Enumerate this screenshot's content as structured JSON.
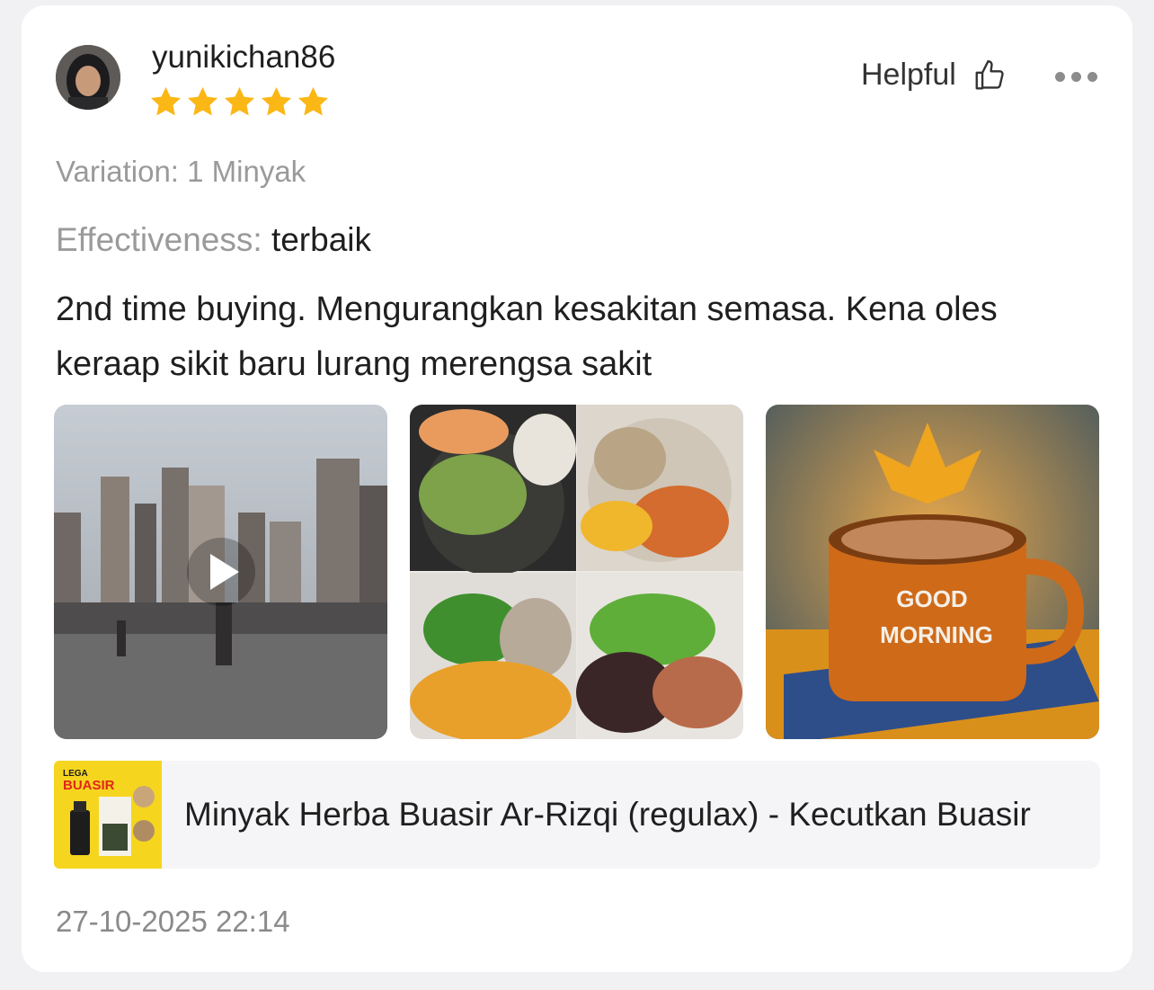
{
  "reviewer": {
    "username": "yunikichan86",
    "rating": 5,
    "rating_max": 5
  },
  "actions": {
    "helpful_label": "Helpful"
  },
  "review": {
    "variation": "Variation: 1 Minyak",
    "effectiveness_label": "Effectiveness:",
    "effectiveness_value": "terbaik",
    "text": "2nd time buying. Mengurangkan kesakitan semasa. Kena oles keraap sikit baru lurang merengsa sakit"
  },
  "media": [
    {
      "kind": "video",
      "icon": "play-icon"
    },
    {
      "kind": "image"
    },
    {
      "kind": "image",
      "caption_line1": "GOOD",
      "caption_line2": "MORNING"
    }
  ],
  "product": {
    "name": "Minyak Herba Buasir Ar-Rizqi (regulax) - Kecutkan Buasir",
    "thumb_brand_top": "LEGA",
    "thumb_brand_main": "BUASIR"
  },
  "timestamp": "27-10-2025 22:14",
  "colors": {
    "star": "#fbb715",
    "card": "#ffffff",
    "background": "#f1f1f3"
  }
}
